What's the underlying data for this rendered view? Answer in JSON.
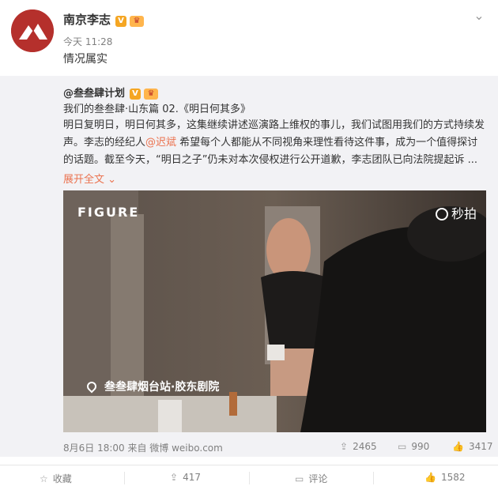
{
  "post": {
    "username": "南京李志",
    "time": "今天 11:28",
    "text": "情况属实",
    "menu_icon": "chevron-down-icon"
  },
  "repost": {
    "username": "@叁叁肆计划",
    "title": "我们的叁叁肆·山东篇 02.《明日何其多》",
    "body_1": "明日复明日，明日何其多，这集继续讲述巡演路上维权的事儿，我们试图用我们的方式持续发声。李志的经纪人",
    "mention": "@迟斌",
    "body_2": " 希望每个人都能从不同视角来理性看待这件事，成为一个值得探讨的话题。截至今天，“明日之子”仍未对本次侵权进行公开道歉，李志团队已向法院提起诉 ...",
    "expand": "展开全文",
    "video": {
      "brand": "FIGURE",
      "watermark": "秒拍",
      "location": "叁叁肆烟台站·胶东剧院"
    },
    "meta": "8月6日 18:00 来自 微博 weibo.com",
    "shares": "2465",
    "comments": "990",
    "likes": "3417"
  },
  "actions": {
    "collect": "收藏",
    "repost": "417",
    "comment": "评论",
    "like": "1582"
  },
  "colors": {
    "accent": "#eb7350",
    "repost_bg": "#f2f2f5",
    "avatar": "#b5302c"
  }
}
